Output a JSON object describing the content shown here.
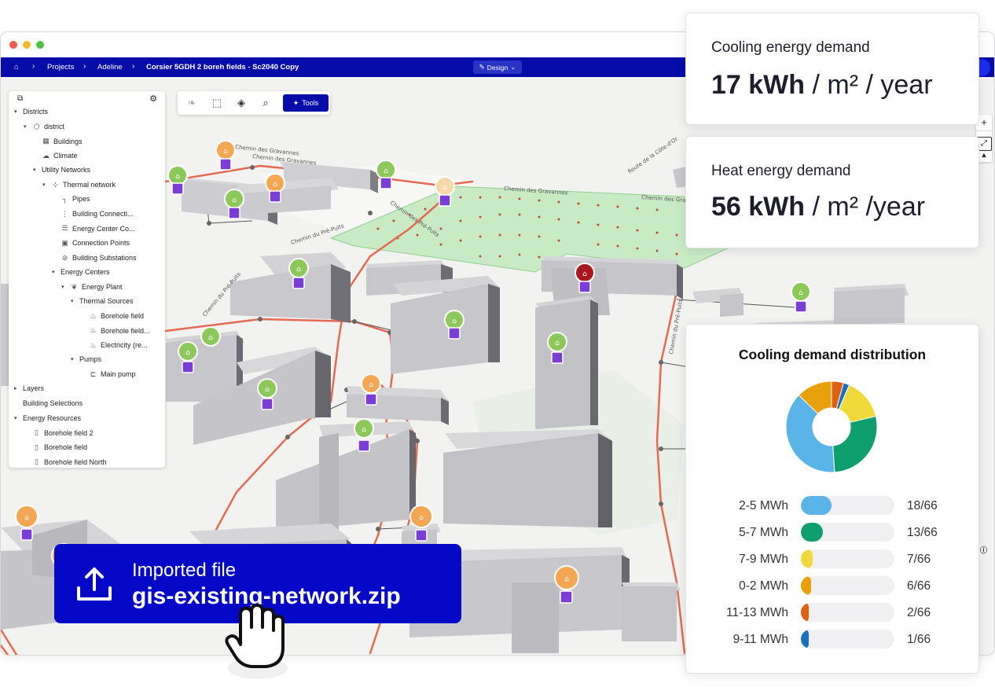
{
  "window": {
    "breadcrumb": {
      "items": [
        "Projects",
        "Adeline"
      ],
      "current": "Corsier 5GDH 2 boreh fields - Sc2040 Copy"
    },
    "mode_button": "Design"
  },
  "map": {
    "street_labels": [
      "Chemin des Gravannes",
      "Chemin des Gravannes",
      "Chemin du Pré-Puits",
      "Chemin du Pré-Puits",
      "Chemin des Gravannes",
      "Route de la Côte-d'Or",
      "Chemin des Ambys",
      "Chemin des Gravannes",
      "Chemin des Pré-Puits",
      "Chemin du Pré-Puits"
    ],
    "zoom_in": "+",
    "zoom_out": "−"
  },
  "sidebar": {
    "items": [
      {
        "label": "Districts",
        "level": 0,
        "caret": "▾"
      },
      {
        "label": "district",
        "level": 1,
        "caret": "▾",
        "icon": "⬡"
      },
      {
        "label": "Buildings",
        "level": 2,
        "icon": "▦"
      },
      {
        "label": "Climate",
        "level": 2,
        "icon": "☁"
      },
      {
        "label": "Utility Networks",
        "level": 2,
        "caret": "▾"
      },
      {
        "label": "Thermal network",
        "level": 3,
        "caret": "▾",
        "icon": "⊹"
      },
      {
        "label": "Pipes",
        "level": 4,
        "icon": "┐"
      },
      {
        "label": "Building Connecti...",
        "level": 4,
        "icon": "⋮"
      },
      {
        "label": "Energy Center Co...",
        "level": 4,
        "icon": "☰"
      },
      {
        "label": "Connection Points",
        "level": 4,
        "icon": "▣"
      },
      {
        "label": "Building Substations",
        "level": 4,
        "icon": "⊘"
      },
      {
        "label": "Energy Centers",
        "level": 4,
        "caret": "▾"
      },
      {
        "label": "Energy Plant",
        "level": 5,
        "caret": "▾",
        "icon": "❦"
      },
      {
        "label": "Thermal Sources",
        "level": 6,
        "caret": "▾"
      },
      {
        "label": "Borehole field",
        "level": 7,
        "icon": "♨"
      },
      {
        "label": "Borehole field...",
        "level": 7,
        "icon": "♨"
      },
      {
        "label": "Electricity (re...",
        "level": 7,
        "icon": "♨"
      },
      {
        "label": "Pumps",
        "level": 6,
        "caret": "▾"
      },
      {
        "label": "Main pump",
        "level": 7,
        "icon": "⊏"
      },
      {
        "label": "Layers",
        "level": 0,
        "caret": "▸"
      },
      {
        "label": "Building Selections",
        "level": 0
      },
      {
        "label": "Energy Resources",
        "level": 0,
        "caret": "▾"
      },
      {
        "label": "Borehole field 2",
        "level": 1,
        "icon": "▯"
      },
      {
        "label": "Borehole field",
        "level": 1,
        "icon": "▯"
      },
      {
        "label": "Borehole field North",
        "level": 1,
        "icon": "▯"
      }
    ]
  },
  "toolbar": {
    "tools_label": "Tools"
  },
  "cooling_card": {
    "label": "Cooling energy demand",
    "value": "17 kWh",
    "unit": " / m² / year"
  },
  "heat_card": {
    "label": "Heat energy demand",
    "value": "56 kWh",
    "unit": " / m² /year"
  },
  "chart_data": {
    "type": "pie",
    "title": "Cooling demand distribution",
    "total": 66,
    "categories": [
      "2-5 MWh",
      "5-7 MWh",
      "7-9 MWh",
      "0-2 MWh",
      "11-13 MWh",
      "9-11 MWh"
    ],
    "values": [
      18,
      13,
      7,
      6,
      2,
      1
    ],
    "counts": [
      "18/66",
      "13/66",
      "7/66",
      "6/66",
      "2/66",
      "1/66"
    ],
    "colors": [
      "#5ab4e8",
      "#0f9e6e",
      "#f0d93a",
      "#e8a00c",
      "#e06010",
      "#1a70c0"
    ],
    "donut_order": [
      1,
      2,
      3,
      4,
      5,
      0
    ]
  },
  "import": {
    "label": "Imported file",
    "filename": "gis-existing-network.zip"
  },
  "colors": {
    "nav": "#050ca8",
    "accent": "#0509c7",
    "green_marker": "#8cc85a",
    "orange_marker": "#f3a752",
    "red_marker": "#a8181e",
    "pipe": "#e56a52",
    "purple": "#7a3ed6"
  }
}
